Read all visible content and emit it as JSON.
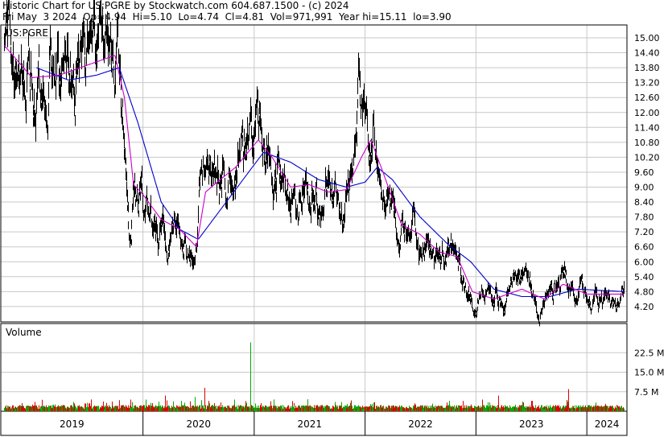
{
  "header": {
    "line1": "Historic Chart for US:PGRE by Stockwatch.com 604.687.1500 - (c) 2024",
    "line2": "Fri May  3 2024  Op=4.94  Hi=5.10  Lo=4.74  Cl=4.81  Vol=971,991  Year hi=15.11  lo=3.90"
  },
  "price_panel": {
    "symbol_label": "US:PGRE",
    "y_ticks": [
      "15.00",
      "14.40",
      "13.80",
      "13.20",
      "12.60",
      "12.00",
      "11.40",
      "10.80",
      "10.20",
      "9.60",
      "9.00",
      "8.40",
      "7.80",
      "7.20",
      "6.60",
      "6.00",
      "5.40",
      "4.80",
      "4.20"
    ]
  },
  "volume_panel": {
    "label": "Volume",
    "y_ticks": [
      "22.5 M",
      "15.0 M",
      "7.5 M"
    ]
  },
  "x_axis": {
    "years": [
      "2019",
      "2020",
      "2021",
      "2022",
      "2023",
      "2024"
    ]
  },
  "colors": {
    "price_bar": "#000000",
    "ma_short": "#cc00cc",
    "ma_long": "#0000cc",
    "volume_up": "#00aa00",
    "volume_down": "#dd0000",
    "grid": "#c8c8c8"
  },
  "chart_data": {
    "type": "line",
    "title": "Historic Chart for US:PGRE",
    "ylabel": "",
    "ylim": [
      3.9,
      15.3
    ],
    "y_ticks": [
      15.0,
      14.4,
      13.8,
      13.2,
      12.6,
      12.0,
      11.4,
      10.8,
      10.2,
      9.6,
      9.0,
      8.4,
      7.8,
      7.2,
      6.6,
      6.0,
      5.4,
      4.8,
      4.2
    ],
    "x_years": [
      "2019",
      "2020",
      "2021",
      "2022",
      "2023",
      "2024"
    ],
    "price_anchors": [
      [
        "2018-10-01",
        14.8
      ],
      [
        "2018-11-01",
        14.5
      ],
      [
        "2018-12-15",
        13.6
      ],
      [
        "2019-01-15",
        13.0
      ],
      [
        "2019-02-15",
        12.9
      ],
      [
        "2019-03-15",
        13.3
      ],
      [
        "2019-04-15",
        13.6
      ],
      [
        "2019-06-01",
        13.9
      ],
      [
        "2019-07-15",
        14.0
      ],
      [
        "2019-09-01",
        14.2
      ],
      [
        "2019-10-01",
        14.6
      ],
      [
        "2019-10-10",
        14.0
      ],
      [
        "2019-10-25",
        11.8
      ],
      [
        "2019-11-05",
        10.5
      ],
      [
        "2019-11-15",
        8.0
      ],
      [
        "2019-11-22",
        6.6
      ],
      [
        "2019-12-01",
        8.5
      ],
      [
        "2019-12-15",
        9.2
      ],
      [
        "2020-01-01",
        8.8
      ],
      [
        "2020-01-20",
        8.6
      ],
      [
        "2020-02-15",
        8.0
      ],
      [
        "2020-03-01",
        7.4
      ],
      [
        "2020-03-15",
        7.0
      ],
      [
        "2020-04-01",
        7.1
      ],
      [
        "2020-05-01",
        7.3
      ],
      [
        "2020-05-20",
        7.0
      ],
      [
        "2020-06-10",
        6.2
      ],
      [
        "2020-06-20",
        5.9
      ],
      [
        "2020-07-01",
        8.2
      ],
      [
        "2020-07-15",
        9.9
      ],
      [
        "2020-08-01",
        9.4
      ],
      [
        "2020-09-01",
        9.0
      ],
      [
        "2020-10-01",
        9.2
      ],
      [
        "2020-11-01",
        10.0
      ],
      [
        "2020-12-01",
        10.6
      ],
      [
        "2021-01-01",
        11.0
      ],
      [
        "2021-01-20",
        11.6
      ],
      [
        "2021-02-05",
        10.3
      ],
      [
        "2021-03-01",
        10.0
      ],
      [
        "2021-03-25",
        9.2
      ],
      [
        "2021-04-20",
        8.8
      ],
      [
        "2021-05-20",
        8.9
      ],
      [
        "2021-06-20",
        9.3
      ],
      [
        "2021-07-20",
        8.9
      ],
      [
        "2021-08-10",
        8.1
      ],
      [
        "2021-08-25",
        8.7
      ],
      [
        "2021-09-20",
        9.1
      ],
      [
        "2021-10-15",
        8.7
      ],
      [
        "2021-11-10",
        9.0
      ],
      [
        "2021-12-01",
        9.6
      ],
      [
        "2021-12-10",
        11.3
      ],
      [
        "2021-12-20",
        10.8
      ],
      [
        "2022-01-10",
        11.0
      ],
      [
        "2022-01-25",
        10.6
      ],
      [
        "2022-02-10",
        9.9
      ],
      [
        "2022-03-01",
        9.1
      ],
      [
        "2022-03-20",
        8.5
      ],
      [
        "2022-04-10",
        7.6
      ],
      [
        "2022-05-01",
        7.1
      ],
      [
        "2022-05-20",
        7.4
      ],
      [
        "2022-06-10",
        7.7
      ],
      [
        "2022-06-25",
        7.0
      ],
      [
        "2022-07-20",
        6.4
      ],
      [
        "2022-08-20",
        6.5
      ],
      [
        "2022-09-20",
        6.1
      ],
      [
        "2022-10-15",
        6.4
      ],
      [
        "2022-11-01",
        6.1
      ],
      [
        "2022-11-20",
        5.3
      ],
      [
        "2022-12-10",
        4.5
      ],
      [
        "2022-12-25",
        4.3
      ],
      [
        "2023-01-20",
        4.5
      ],
      [
        "2023-02-20",
        4.6
      ],
      [
        "2023-03-20",
        4.5
      ],
      [
        "2023-04-20",
        4.8
      ],
      [
        "2023-05-20",
        5.1
      ],
      [
        "2023-06-20",
        4.9
      ],
      [
        "2023-07-20",
        4.4
      ],
      [
        "2023-08-10",
        4.3
      ],
      [
        "2023-09-01",
        4.5
      ],
      [
        "2023-09-25",
        4.8
      ],
      [
        "2023-10-10",
        5.5
      ],
      [
        "2023-10-25",
        5.1
      ],
      [
        "2023-11-15",
        4.7
      ],
      [
        "2023-12-10",
        4.8
      ],
      [
        "2024-01-10",
        4.5
      ],
      [
        "2024-02-10",
        4.6
      ],
      [
        "2024-03-10",
        4.5
      ],
      [
        "2024-04-10",
        4.7
      ],
      [
        "2024-05-03",
        4.81
      ]
    ],
    "ma_short_anchors": [
      [
        "2018-10-01",
        14.7
      ],
      [
        "2019-01-01",
        13.4
      ],
      [
        "2019-04-01",
        13.5
      ],
      [
        "2019-07-01",
        13.9
      ],
      [
        "2019-10-01",
        14.3
      ],
      [
        "2019-11-01",
        12.6
      ],
      [
        "2019-12-01",
        9.1
      ],
      [
        "2020-01-01",
        8.7
      ],
      [
        "2020-03-01",
        7.7
      ],
      [
        "2020-05-01",
        7.3
      ],
      [
        "2020-06-25",
        6.6
      ],
      [
        "2020-07-25",
        8.8
      ],
      [
        "2020-09-01",
        9.2
      ],
      [
        "2020-11-01",
        9.8
      ],
      [
        "2021-01-15",
        10.9
      ],
      [
        "2021-03-01",
        10.2
      ],
      [
        "2021-05-01",
        9.0
      ],
      [
        "2021-07-01",
        9.1
      ],
      [
        "2021-09-01",
        8.8
      ],
      [
        "2021-11-01",
        8.9
      ],
      [
        "2021-12-20",
        10.2
      ],
      [
        "2022-01-20",
        10.9
      ],
      [
        "2022-03-01",
        9.6
      ],
      [
        "2022-05-01",
        7.5
      ],
      [
        "2022-07-01",
        7.1
      ],
      [
        "2022-09-01",
        6.4
      ],
      [
        "2022-11-01",
        6.2
      ],
      [
        "2022-12-20",
        4.8
      ],
      [
        "2023-03-01",
        4.5
      ],
      [
        "2023-06-01",
        4.9
      ],
      [
        "2023-08-15",
        4.5
      ],
      [
        "2023-10-15",
        5.1
      ],
      [
        "2024-01-01",
        4.7
      ],
      [
        "2024-05-03",
        4.7
      ]
    ],
    "ma_long_anchors": [
      [
        "2019-01-15",
        13.8
      ],
      [
        "2019-05-01",
        13.3
      ],
      [
        "2019-08-01",
        13.5
      ],
      [
        "2019-10-15",
        13.8
      ],
      [
        "2019-12-15",
        11.6
      ],
      [
        "2020-03-01",
        8.4
      ],
      [
        "2020-05-01",
        7.3
      ],
      [
        "2020-07-01",
        6.9
      ],
      [
        "2020-10-01",
        8.4
      ],
      [
        "2021-01-01",
        9.9
      ],
      [
        "2021-02-01",
        10.4
      ],
      [
        "2021-05-01",
        10.0
      ],
      [
        "2021-08-01",
        9.3
      ],
      [
        "2021-11-01",
        9.0
      ],
      [
        "2022-01-01",
        9.2
      ],
      [
        "2022-02-10",
        9.8
      ],
      [
        "2022-04-01",
        9.3
      ],
      [
        "2022-07-01",
        7.8
      ],
      [
        "2022-10-01",
        6.7
      ],
      [
        "2022-12-15",
        6.0
      ],
      [
        "2023-03-01",
        4.9
      ],
      [
        "2023-06-01",
        4.6
      ],
      [
        "2023-09-01",
        4.6
      ],
      [
        "2023-12-01",
        4.9
      ],
      [
        "2024-05-03",
        4.8
      ]
    ],
    "volume_ylim": [
      0,
      30
    ],
    "volume_unit": "M",
    "volume_spikes": [
      [
        "2019-11-20",
        4.5
      ],
      [
        "2020-03-15",
        6.0
      ],
      [
        "2020-05-05",
        4.0
      ],
      [
        "2020-06-20",
        5.5
      ],
      [
        "2020-07-20",
        9.0
      ],
      [
        "2020-12-18",
        26.5
      ],
      [
        "2022-02-01",
        3.5
      ],
      [
        "2022-11-20",
        4.0
      ],
      [
        "2023-01-20",
        4.5
      ],
      [
        "2023-03-15",
        6.0
      ],
      [
        "2023-07-01",
        4.0
      ],
      [
        "2023-11-01",
        8.5
      ]
    ]
  }
}
